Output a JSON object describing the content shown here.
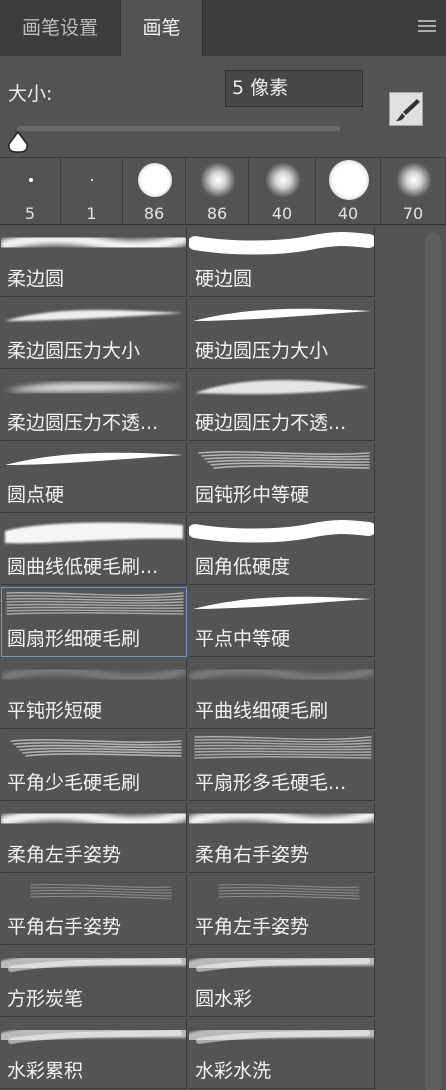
{
  "tabs": [
    {
      "label": "画笔设置"
    },
    {
      "label": "画笔"
    }
  ],
  "size": {
    "label": "大小:",
    "value": "5 像素"
  },
  "tips": [
    {
      "size": "5",
      "icon": "tiny-hard-dot"
    },
    {
      "size": "1",
      "icon": "tiny-dot"
    },
    {
      "size": "86",
      "icon": "hard-round-tip"
    },
    {
      "size": "86",
      "icon": "soft-round-tip"
    },
    {
      "size": "40",
      "icon": "soft-round-tip"
    },
    {
      "size": "40",
      "icon": "hard-round-tip"
    },
    {
      "size": "70",
      "icon": "soft-round-tip"
    }
  ],
  "brushes": [
    {
      "label": "柔边圆",
      "stroke": "soft"
    },
    {
      "label": "硬边圆",
      "stroke": "hard"
    },
    {
      "label": "柔边圆压力大小",
      "stroke": "taper-soft"
    },
    {
      "label": "硬边圆压力大小",
      "stroke": "taper-hard"
    },
    {
      "label": "柔边圆压力不透...",
      "stroke": "soft-fade"
    },
    {
      "label": "硬边圆压力不透...",
      "stroke": "hard-fade"
    },
    {
      "label": "圆点硬",
      "stroke": "taper-hard"
    },
    {
      "label": "园钝形中等硬",
      "stroke": "bristle"
    },
    {
      "label": "圆曲线低硬毛刷...",
      "stroke": "bristle-heavy"
    },
    {
      "label": "圆角低硬度",
      "stroke": "hard"
    },
    {
      "label": "圆扇形细硬毛刷",
      "stroke": "fan"
    },
    {
      "label": "平点中等硬",
      "stroke": "taper-hard"
    },
    {
      "label": "平钝形短硬",
      "stroke": "faint"
    },
    {
      "label": "平曲线细硬毛刷",
      "stroke": "faint"
    },
    {
      "label": "平角少毛硬毛刷",
      "stroke": "bristle"
    },
    {
      "label": "平扇形多毛硬毛...",
      "stroke": "fan"
    },
    {
      "label": "柔角左手姿势",
      "stroke": "soft"
    },
    {
      "label": "柔角右手姿势",
      "stroke": "soft"
    },
    {
      "label": "平角右手姿势",
      "stroke": "faint-lines"
    },
    {
      "label": "平角左手姿势",
      "stroke": "faint-lines"
    },
    {
      "label": "方形炭笔",
      "stroke": "charcoal"
    },
    {
      "label": "圆水彩",
      "stroke": "charcoal"
    },
    {
      "label": "水彩累积",
      "stroke": "charcoal"
    },
    {
      "label": "水彩水洗",
      "stroke": "charcoal"
    }
  ],
  "selected_brush": "圆扇形细硬毛刷",
  "colors": {
    "panel": "#535353",
    "tabbar": "#3c3c3c",
    "selection": "#7a93c2"
  }
}
